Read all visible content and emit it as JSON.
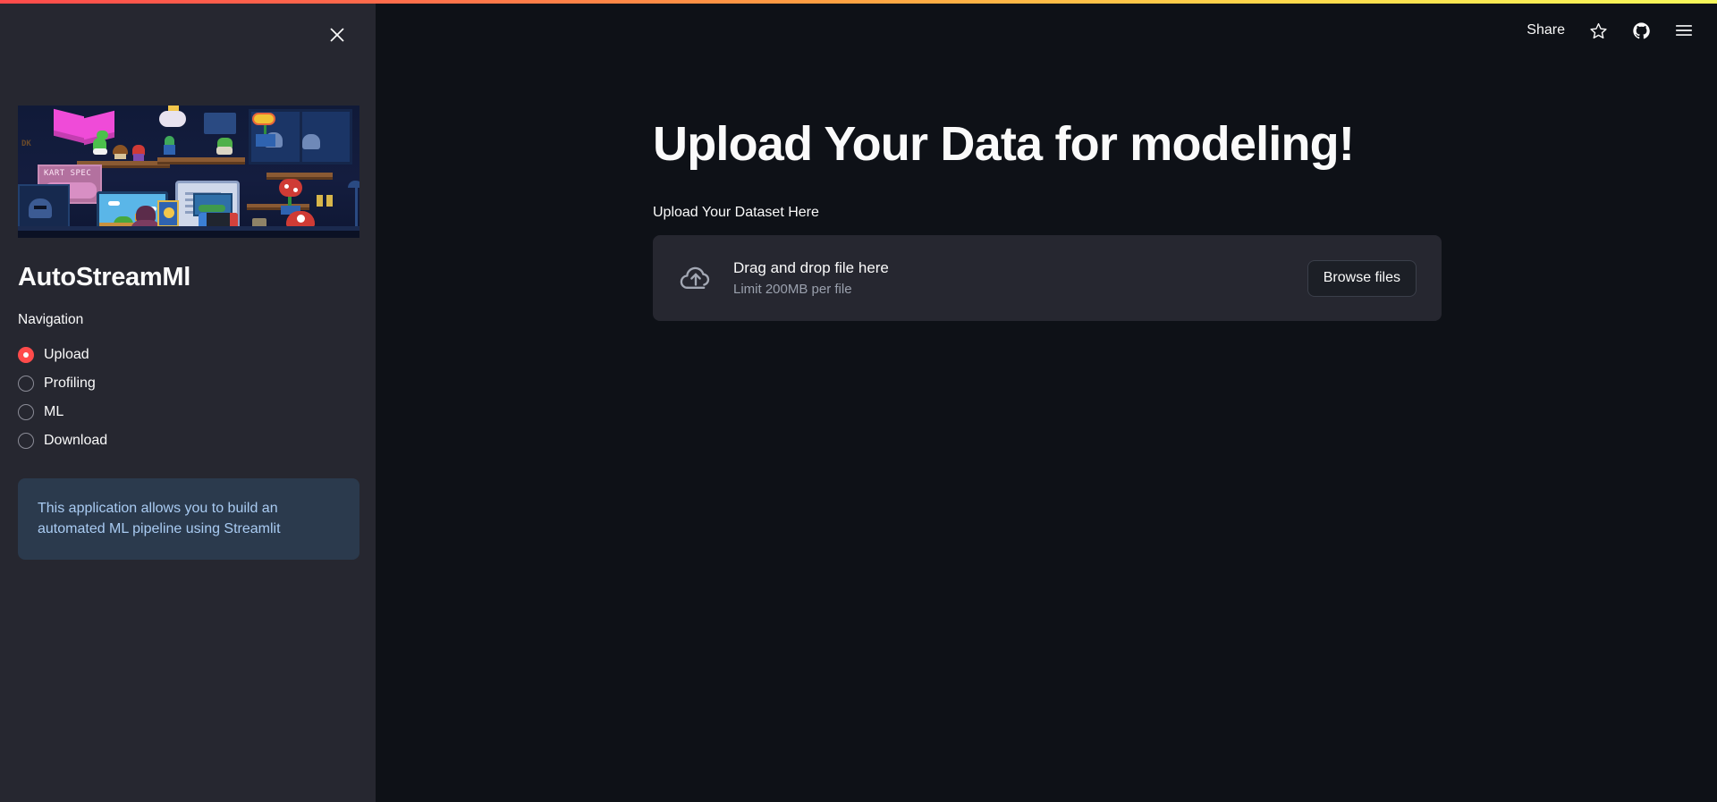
{
  "top_bar": {
    "gradient_from": "#ff4b4b",
    "gradient_mid": "#ff9f42",
    "gradient_to": "#f7f95a"
  },
  "toolbar": {
    "share_label": "Share",
    "star_icon": "star-icon",
    "github_icon": "github-icon",
    "menu_icon": "hamburger-menu-icon"
  },
  "sidebar": {
    "close_icon": "close-icon",
    "banner": {
      "alt": "pixel-art retro gaming room banner",
      "poster_text": "KART SPEC",
      "graffiti_text": "DK"
    },
    "app_title": "AutoStreamMl",
    "nav_label": "Navigation",
    "nav_items": [
      {
        "label": "Upload",
        "selected": true
      },
      {
        "label": "Profiling",
        "selected": false
      },
      {
        "label": "ML",
        "selected": false
      },
      {
        "label": "Download",
        "selected": false
      }
    ],
    "info_text": "This application allows you to build an automated ML pipeline using Streamlit",
    "accent_color": "#ff4b4b",
    "background_color": "#262730",
    "info_background": "#2b3a4d"
  },
  "main": {
    "page_title": "Upload Your Data for modeling!",
    "sub_label": "Upload Your Dataset Here",
    "uploader": {
      "icon": "cloud-upload-icon",
      "drop_text": "Drag and drop file here",
      "limit_text": "Limit 200MB per file",
      "browse_label": "Browse files"
    },
    "background_color": "#0e1117"
  }
}
